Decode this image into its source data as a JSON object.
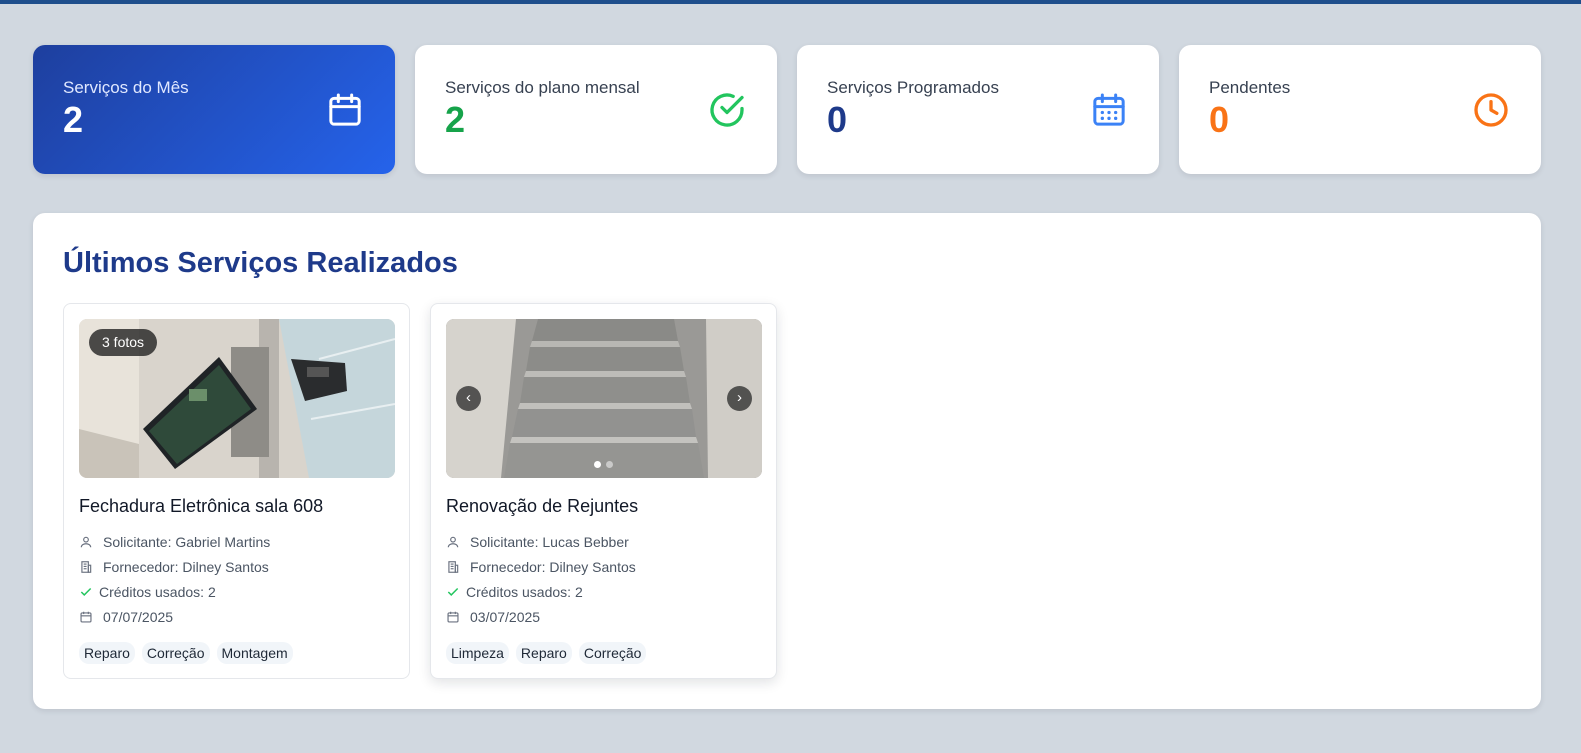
{
  "stats": [
    {
      "label": "Serviços do Mês",
      "value": "2",
      "icon": "calendar-icon"
    },
    {
      "label": "Serviços do plano mensal",
      "value": "2",
      "icon": "check-circle-icon"
    },
    {
      "label": "Serviços Programados",
      "value": "0",
      "icon": "calendar-grid-icon"
    },
    {
      "label": "Pendentes",
      "value": "0",
      "icon": "clock-icon"
    }
  ],
  "colors": {
    "primary": "#1e3a8a",
    "green": "#16a34a",
    "orange": "#f97316",
    "blue": "#3b82f6"
  },
  "services": {
    "title": "Últimos Serviços Realizados",
    "cards": [
      {
        "photo_badge": "3 fotos",
        "title": "Fechadura Eletrônica sala 608",
        "requester": "Solicitante: Gabriel Martins",
        "supplier": "Fornecedor: Dilney Santos",
        "credits": "Créditos usados: 2",
        "date": "07/07/2025",
        "tags": [
          "Reparo",
          "Correção",
          "Montagem"
        ]
      },
      {
        "photo_badge": "",
        "title": "Renovação de Rejuntes",
        "requester": "Solicitante: Lucas Bebber",
        "supplier": "Fornecedor: Dilney Santos",
        "credits": "Créditos usados: 2",
        "date": "03/07/2025",
        "tags": [
          "Limpeza",
          "Reparo",
          "Correção"
        ],
        "carousel": {
          "prev": "‹",
          "next": "›",
          "total_photos": 2,
          "active_index": 0
        }
      }
    ]
  }
}
